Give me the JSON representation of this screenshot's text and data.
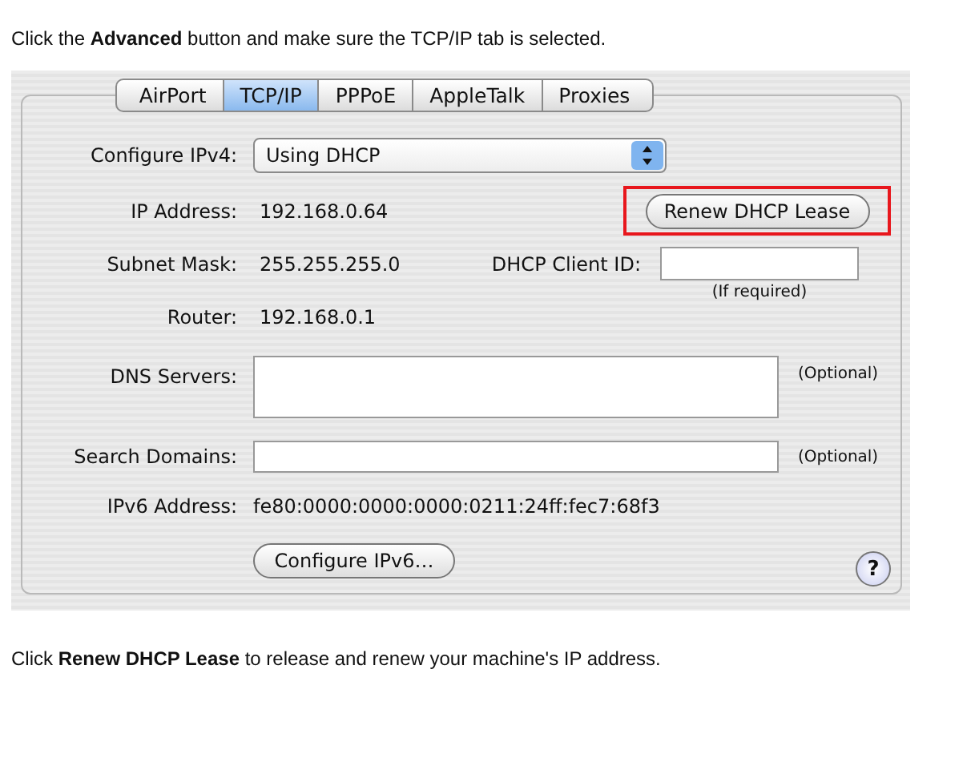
{
  "instruction_top": "Click the **Advanced** button and make sure the TCP/IP tab is selected.",
  "tabs": [
    {
      "label": "AirPort",
      "selected": false
    },
    {
      "label": "TCP/IP",
      "selected": true
    },
    {
      "label": "PPPoE",
      "selected": false
    },
    {
      "label": "AppleTalk",
      "selected": false
    },
    {
      "label": "Proxies",
      "selected": false
    }
  ],
  "configure_ipv4": {
    "label": "Configure IPv4:",
    "value": "Using DHCP"
  },
  "ip_address": {
    "label": "IP Address:",
    "value": "192.168.0.64"
  },
  "renew_button": {
    "label": "Renew DHCP Lease",
    "highlighted": true
  },
  "subnet_mask": {
    "label": "Subnet Mask:",
    "value": "255.255.255.0"
  },
  "dhcp_client_id": {
    "label": "DHCP Client ID:",
    "note": "(If required)"
  },
  "router": {
    "label": "Router:",
    "value": "192.168.0.1"
  },
  "dns_servers": {
    "label": "DNS Servers:",
    "note": "(Optional)"
  },
  "search_domains": {
    "label": "Search Domains:",
    "note": "(Optional)"
  },
  "ipv6_address": {
    "label": "IPv6 Address:",
    "value": "fe80:0000:0000:0000:0211:24ff:fec7:68f3"
  },
  "configure_ipv6_button": {
    "label": "Configure IPv6…"
  },
  "help_button": {
    "label": "?"
  },
  "instruction_bottom": "Click **Renew DHCP Lease** to release and renew your machine's IP address."
}
